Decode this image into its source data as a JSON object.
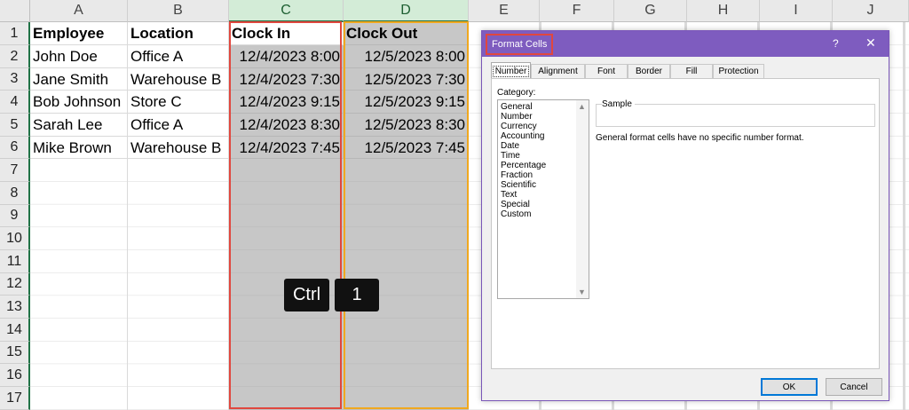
{
  "sheet": {
    "columns": [
      "A",
      "B",
      "C",
      "D",
      "E",
      "F",
      "G",
      "H",
      "I",
      "J"
    ],
    "rows": [
      "1",
      "2",
      "3",
      "4",
      "5",
      "6",
      "7",
      "8",
      "9",
      "10",
      "11",
      "12",
      "13",
      "14",
      "15",
      "16",
      "17"
    ],
    "headers": {
      "employee": "Employee",
      "location": "Location",
      "clock_in": "Clock In",
      "clock_out": "Clock Out"
    },
    "records": [
      {
        "employee": "John Doe",
        "location": "Office A",
        "clock_in": "12/4/2023 8:00",
        "clock_out": "12/5/2023 8:00"
      },
      {
        "employee": "Jane Smith",
        "location": "Warehouse B",
        "clock_in": "12/4/2023 7:30",
        "clock_out": "12/5/2023 7:30"
      },
      {
        "employee": "Bob Johnson",
        "location": "Store C",
        "clock_in": "12/4/2023 9:15",
        "clock_out": "12/5/2023 9:15"
      },
      {
        "employee": "Sarah Lee",
        "location": "Office A",
        "clock_in": "12/4/2023 8:30",
        "clock_out": "12/5/2023 8:30"
      },
      {
        "employee": "Mike Brown",
        "location": "Warehouse B",
        "clock_in": "12/4/2023 7:45",
        "clock_out": "12/5/2023 7:45"
      }
    ],
    "selected_columns": [
      "C",
      "D"
    ]
  },
  "shortcut": {
    "key1": "Ctrl",
    "key2": "1"
  },
  "dialog": {
    "title": "Format Cells",
    "help": "?",
    "close": "✕",
    "tabs": [
      "Number",
      "Alignment",
      "Font",
      "Border",
      "Fill",
      "Protection"
    ],
    "active_tab": "Number",
    "category_label": "Category:",
    "categories": [
      "General",
      "Number",
      "Currency",
      "Accounting",
      "Date",
      "Time",
      "Percentage",
      "Fraction",
      "Scientific",
      "Text",
      "Special",
      "Custom"
    ],
    "sample_label": "Sample",
    "description": "General format cells have no specific number format.",
    "ok": "OK",
    "cancel": "Cancel"
  },
  "colors": {
    "excel_green": "#217346",
    "dialog_purple": "#7e5cbf",
    "highlight_red": "#e0473e",
    "highlight_orange": "#f0a81f",
    "selection_gray": "#c7c7c7"
  }
}
